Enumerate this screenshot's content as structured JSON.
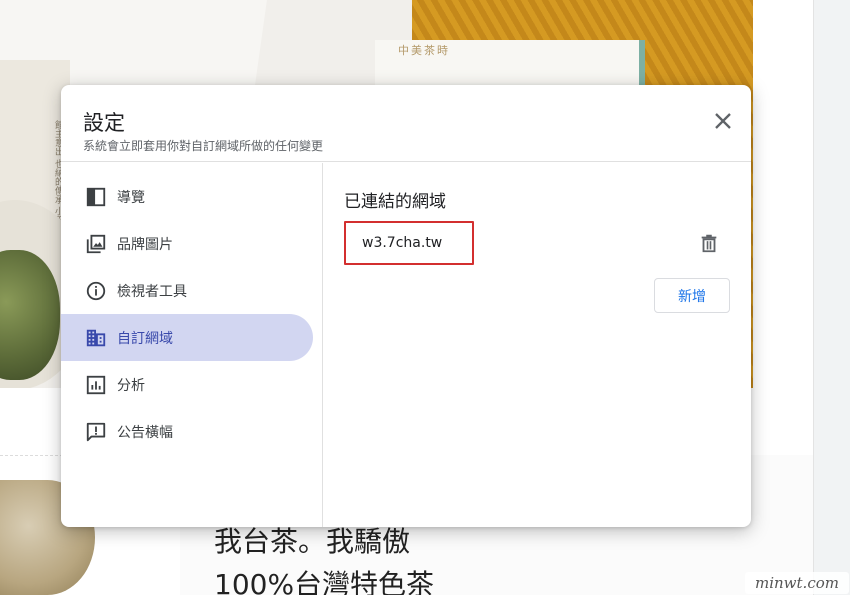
{
  "dialog": {
    "title": "設定",
    "subtitle": "系統會立即套用你對自訂網域所做的任何變更",
    "close_icon": "close-icon"
  },
  "sidebar": {
    "items": [
      {
        "label": "導覽",
        "icon": "navigation-icon",
        "active": false
      },
      {
        "label": "品牌圖片",
        "icon": "brand-images-icon",
        "active": false
      },
      {
        "label": "檢視者工具",
        "icon": "info-icon",
        "active": false
      },
      {
        "label": "自訂網域",
        "icon": "domain-icon",
        "active": true
      },
      {
        "label": "分析",
        "icon": "analytics-icon",
        "active": false
      },
      {
        "label": "公告橫幅",
        "icon": "announcement-icon",
        "active": false
      }
    ]
  },
  "content": {
    "section_title": "已連結的網域",
    "domains": [
      "w3.7cha.tw"
    ],
    "delete_icon": "trash-icon",
    "add_label": "新增"
  },
  "background": {
    "headline_1": "我台茶。我驕傲",
    "headline_2": "100%台灣特色茶",
    "teabox_logo": "中美茶時",
    "book_text": "館主意出 也納的傳承 小天獻的"
  },
  "watermark": "minwt.com",
  "colors": {
    "active_nav_bg": "#d2d6f1",
    "active_nav_text": "#3949ab",
    "link_blue": "#1a73e8",
    "highlight_red": "#d32f2f"
  }
}
